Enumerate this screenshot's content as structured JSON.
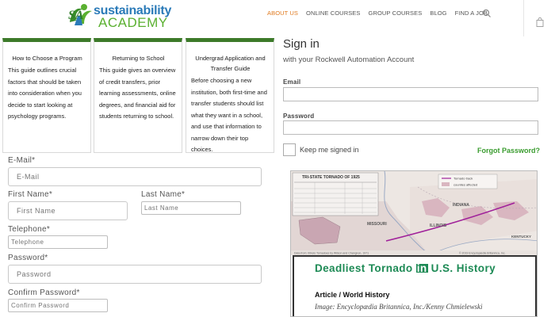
{
  "header": {
    "logo": {
      "text_primary": "sustainability",
      "text_secondary": "ACADEMY",
      "mark": "SA"
    },
    "nav": [
      "ABOUT US",
      "ONLINE COURSES",
      "GROUP COURSES",
      "BLOG",
      "FIND A JOB"
    ],
    "active_nav": "ABOUT US",
    "icons": [
      "search-icon",
      "shopping-bag-icon"
    ],
    "colors": {
      "nav_active": "#e07a1f",
      "logo_blue": "#2a7ab8",
      "logo_green": "#5ab030"
    }
  },
  "cards": [
    {
      "title": "How to Choose a Program",
      "body": "This guide outlines crucial factors that should be taken into consideration when you decide to start looking at psychology programs."
    },
    {
      "title": "Returning to School",
      "body": "This guide gives an overview of credit transfers, prior learning assessments, online degrees, and financial aid for students returning to school."
    },
    {
      "title": "Undergrad Application and Transfer Guide",
      "body": "Before choosing a new institution, both first-time and transfer students should list what they want in a school, and use that information to narrow down their top choices."
    }
  ],
  "card_accent": "#3d7a2a",
  "form": {
    "email": {
      "label": "E-Mail*",
      "placeholder": "E-Mail"
    },
    "first_name": {
      "label": "First Name*",
      "placeholder": "First Name"
    },
    "last_name": {
      "label": "Last Name*",
      "placeholder": "Last Name"
    },
    "telephone": {
      "label": "Telephone*",
      "placeholder": "Telephone"
    },
    "password": {
      "label": "Password*",
      "placeholder": "Password"
    },
    "confirm_password": {
      "label": "Confirm Password*",
      "placeholder": "Confirm Password"
    }
  },
  "signin": {
    "title": "Sign in",
    "subtitle": "with your Rockwell Automation Account",
    "email_label": "Email",
    "password_label": "Password",
    "keep_signed_in": "Keep me signed in",
    "forgot_password": "Forgot Password?",
    "link_color": "#3a9c2f"
  },
  "article": {
    "title_before": "Deadliest Tornado ",
    "title_badge": "in",
    "title_after": " U.S. History",
    "meta": "Article / World History",
    "credit": "Image: Encyclopædia Britannica, Inc./Kenny Chmielewski",
    "map": {
      "table_title": "TRI-STATE TORNADO OF 1925",
      "legend": [
        "Tornado track",
        "counties affected"
      ],
      "states": [
        "MISSOURI",
        "ILLINOIS",
        "INDIANA",
        "KENTUCKY"
      ],
      "footer": "Data from: Illinois Tornadoes by Wilson and Changnon, 1971",
      "copyright": "© 2019 Encyclopædia Britannica, Inc."
    },
    "title_color": "#1d8a55"
  }
}
